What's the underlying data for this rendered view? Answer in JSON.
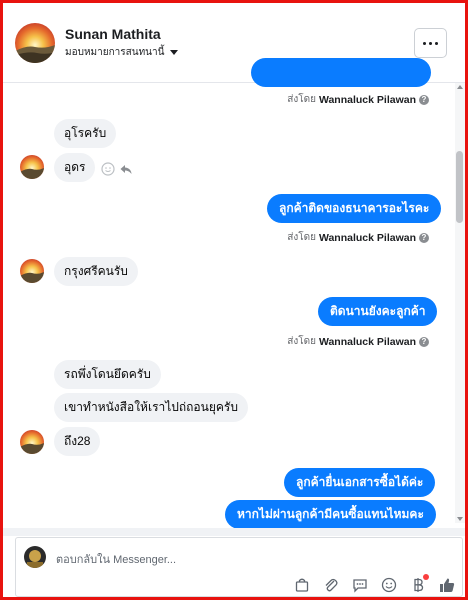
{
  "header": {
    "contact_name": "Sunan Mathita",
    "assign_label": "มอบหมายการสนทนานี้"
  },
  "messages": {
    "sent_by_prefix": "ส่งโดย",
    "agent_name": "Wannaluck Pilawan",
    "info_glyph": "?",
    "in_1": "อุโรครับ",
    "in_2": "อุดร",
    "out_1": "ลูกค้าติดของธนาคารอะไรคะ",
    "in_3": "กรุงศรีคนรับ",
    "out_2": "ติดนานยังคะลูกค้า",
    "in_4": "รถพึ่งโดนยึดครับ",
    "in_5": "เขาทำหนังสือให้เราไปถ่ถอนยุครับ",
    "in_6": "ถึง28",
    "out_3": "ลูกค้ายื่นเอกสารซื้อได้ค่ะ",
    "out_4": "หากไม่ผ่านลูกค้ามีคนซื้อแทนไหมคะ"
  },
  "composer": {
    "placeholder": "ตอบกลับใน Messenger..."
  },
  "colors": {
    "outgoing_bubble": "#0a7cff",
    "incoming_bubble": "#f0f2f5",
    "frame_border": "#e8130f"
  },
  "icons": [
    "more-icon",
    "caret-down-icon",
    "emoji-icon",
    "reply-icon",
    "info-icon",
    "bag-icon",
    "attachment-icon",
    "saved-reply-icon",
    "emoji-picker-icon",
    "baht-icon",
    "like-icon"
  ]
}
